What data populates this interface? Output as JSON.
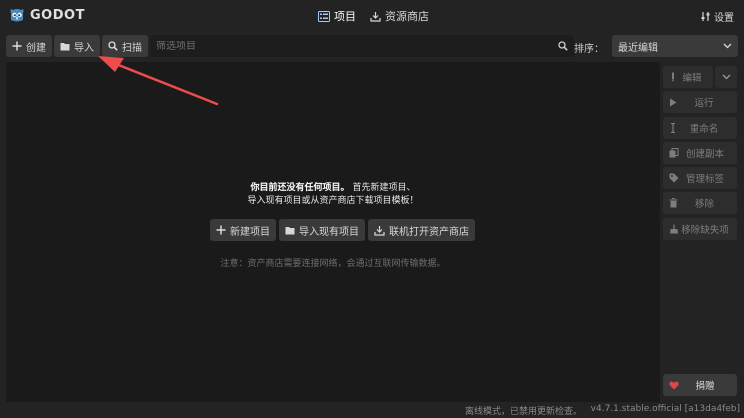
{
  "app": {
    "logo_text": "GODOT",
    "accent_color": "#a8c4ff",
    "heart_color": "#e0464a"
  },
  "topnav": {
    "projects_label": "项目",
    "assetlib_label": "资源商店",
    "settings_label": "设置"
  },
  "toolbar": {
    "create_label": "创建",
    "import_label": "导入",
    "scan_label": "扫描",
    "filter_placeholder": "筛选项目",
    "filter_value": "",
    "sort_label": "排序：",
    "sort_selected": "最近编辑"
  },
  "empty_state": {
    "line1_bold": "你目前还没有任何项目。",
    "line1_rest": "首先新建项目、",
    "line2": "导入现有项目或从资产商店下载项目模板！",
    "new_project_label": "新建项目",
    "import_existing_label": "导入现有项目",
    "open_assetlib_label": "联机打开资产商店",
    "note": "注意：资产商店需要连接网络，会通过互联网传输数据。"
  },
  "sidebar": {
    "edit_label": "编辑",
    "run_label": "运行",
    "rename_label": "重命名",
    "duplicate_label": "创建副本",
    "tags_label": "管理标签",
    "remove_label": "移除",
    "remove_missing_label": "移除缺失项",
    "donate_label": "捐赠"
  },
  "statusbar": {
    "offline_text": "离线模式，已禁用更新检查。",
    "version_text": "v4.7.1.stable.official [a13da4feb]"
  }
}
